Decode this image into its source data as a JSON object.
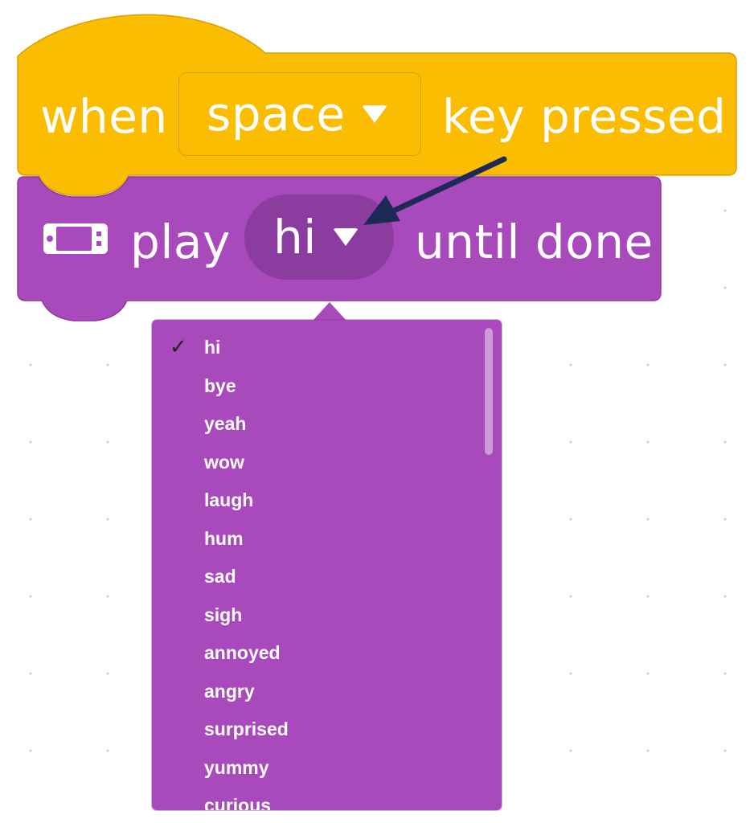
{
  "hat_block": {
    "when_label": "when",
    "key_value": "space",
    "suffix_label": "key pressed",
    "color": "#fbbd02"
  },
  "sound_block": {
    "play_label": "play",
    "sound_value": "hi",
    "suffix_label": "until done",
    "color": "#a94abc",
    "icon": "console-speaker-icon"
  },
  "sound_menu": {
    "selected": "hi",
    "items": [
      {
        "label": "hi",
        "checked": true
      },
      {
        "label": "bye"
      },
      {
        "label": "yeah"
      },
      {
        "label": "wow"
      },
      {
        "label": "laugh"
      },
      {
        "label": "hum"
      },
      {
        "label": "sad"
      },
      {
        "label": "sigh"
      },
      {
        "label": "annoyed"
      },
      {
        "label": "angry"
      },
      {
        "label": "surprised"
      },
      {
        "label": "yummy"
      },
      {
        "label": "curious"
      }
    ]
  },
  "annotation": {
    "arrow_color": "#1c2a55"
  }
}
